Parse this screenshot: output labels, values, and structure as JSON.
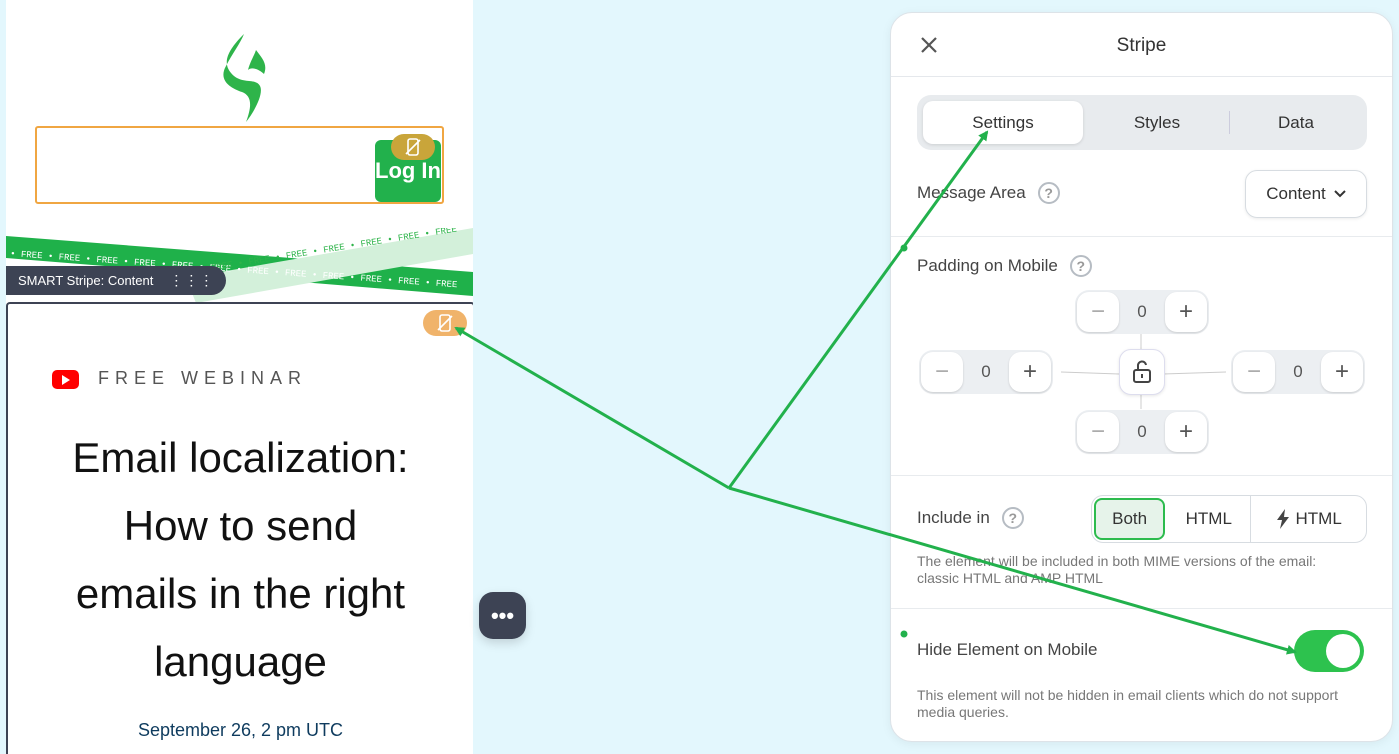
{
  "email": {
    "login_button": "Log In",
    "stripe_label": "SMART Stripe: Content",
    "stripe_text": "FREE",
    "webinar_tag": "FREE WEBINAR",
    "headline_lines": [
      "Email localization:",
      "How to send",
      "emails in the right",
      "language"
    ],
    "date": "September 26, 2 pm UTC"
  },
  "panel": {
    "title": "Stripe",
    "tabs": [
      "Settings",
      "Styles",
      "Data"
    ],
    "active_tab": "Settings",
    "message_area": {
      "label": "Message Area",
      "value": "Content"
    },
    "padding": {
      "label": "Padding on Mobile",
      "top": "0",
      "left": "0",
      "right": "0",
      "bottom": "0"
    },
    "include_in": {
      "label": "Include in",
      "options": [
        "Both",
        "HTML",
        "HTML"
      ],
      "selected": "Both",
      "hint": "The element will be included in both MIME versions of the email: classic HTML and AMP HTML"
    },
    "hide_on_mobile": {
      "label": "Hide Element on Mobile",
      "enabled": true,
      "hint": "This element will not be hidden in email clients which do not support media queries."
    }
  },
  "colors": {
    "accent_green": "#2dc24e",
    "dark": "#3d4354",
    "orange": "#f0a642",
    "canvas_bg": "#e3f7fd"
  },
  "icons": [
    "close-icon",
    "help-icon",
    "chevron-down-icon",
    "minus-icon",
    "plus-icon",
    "lock-open-icon",
    "lightning-icon",
    "hidden-mobile-icon",
    "youtube-icon",
    "more-icon",
    "logo-icon"
  ]
}
